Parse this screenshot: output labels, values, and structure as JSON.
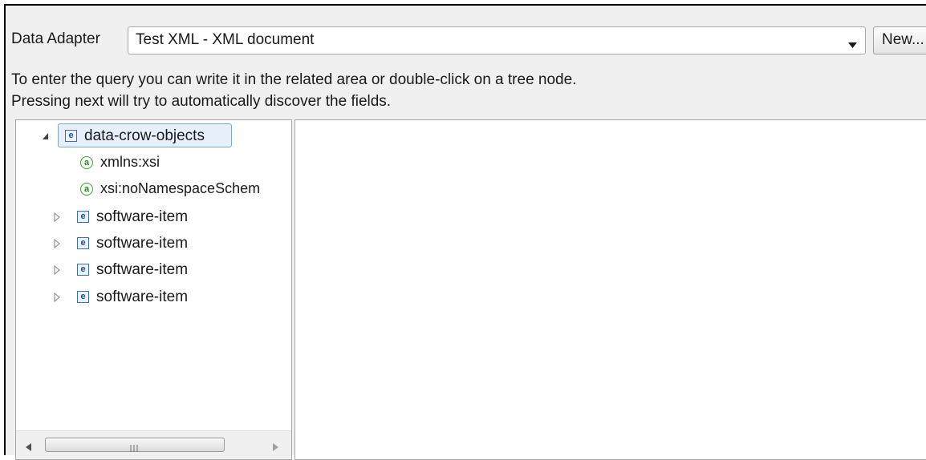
{
  "header": {
    "data_adapter_label": "Data Adapter",
    "selected_adapter": "Test XML - XML document",
    "new_button_label": "New..."
  },
  "instructions": {
    "line1": "To enter the query you can write it in the related area or double-click on a tree node.",
    "line2": "Pressing next will try to automatically discover the fields."
  },
  "tree": {
    "root": {
      "label": "data-crow-objects",
      "icon": "element-icon",
      "expanded": true,
      "selected": true
    },
    "attributes": [
      {
        "label": "xmlns:xsi",
        "icon": "attribute-icon"
      },
      {
        "label": "xsi:noNamespaceSchem",
        "icon": "attribute-icon"
      }
    ],
    "children": [
      {
        "label": "software-item",
        "icon": "element-icon",
        "expanded": false
      },
      {
        "label": "software-item",
        "icon": "element-icon",
        "expanded": false
      },
      {
        "label": "software-item",
        "icon": "element-icon",
        "expanded": false
      },
      {
        "label": "software-item",
        "icon": "element-icon",
        "expanded": false
      }
    ]
  },
  "query_area": {
    "text": ""
  },
  "colors": {
    "selection_bg": "#e6f0fb",
    "selection_border": "#7da2ce",
    "element_icon": "#3a6fb6",
    "attribute_icon": "#3e9a3e"
  }
}
